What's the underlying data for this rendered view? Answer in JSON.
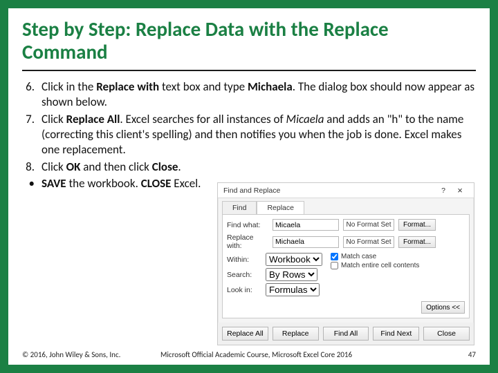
{
  "title": "Step by Step: Replace Data with the Replace Command",
  "steps": {
    "s6": {
      "num": "6.",
      "pre": "Click in the ",
      "b1": "Replace with",
      "mid1": " text box and type ",
      "b2": "Michaela",
      "post": ". The dialog box should now appear as shown below."
    },
    "s7": {
      "num": "7.",
      "pre": "Click ",
      "b1": "Replace All",
      "mid1": ". Excel searches for all instances of ",
      "i1": "Micaela",
      "post": " and adds an \"h\" to the name (correcting this client's spelling) and then notifies you when the job is done. Excel makes one replacement."
    },
    "s8": {
      "num": "8.",
      "pre": "Click ",
      "b1": "OK",
      "mid1": " and then click ",
      "b2": "Close",
      "post": "."
    },
    "s9": {
      "num": "•",
      "b1": "SAVE",
      "mid1": " the workbook. ",
      "b2": "CLOSE",
      "post": " Excel."
    }
  },
  "dialog": {
    "title": "Find and Replace",
    "help": "?",
    "close": "×",
    "tabs": {
      "find": "Find",
      "replace": "Replace"
    },
    "labels": {
      "findwhat": "Find what:",
      "replacewith": "Replace with:",
      "within": "Within:",
      "search": "Search:",
      "lookin": "Look in:"
    },
    "values": {
      "findwhat": "Micaela",
      "replacewith": "Michaela",
      "within": "Workbook",
      "search": "By Rows",
      "lookin": "Formulas"
    },
    "noformat": "No Format Set",
    "formatbtn": "Format...",
    "checks": {
      "matchcase": "Match case",
      "entirecell": "Match entire cell contents"
    },
    "optionsbtn": "Options <<",
    "buttons": {
      "replaceall": "Replace All",
      "replace": "Replace",
      "findall": "Find All",
      "findnext": "Find Next",
      "close": "Close"
    }
  },
  "footer": {
    "copyright": "© 2016, John Wiley & Sons, Inc.",
    "course": "Microsoft Official Academic Course, Microsoft Excel Core 2016",
    "page": "47"
  }
}
